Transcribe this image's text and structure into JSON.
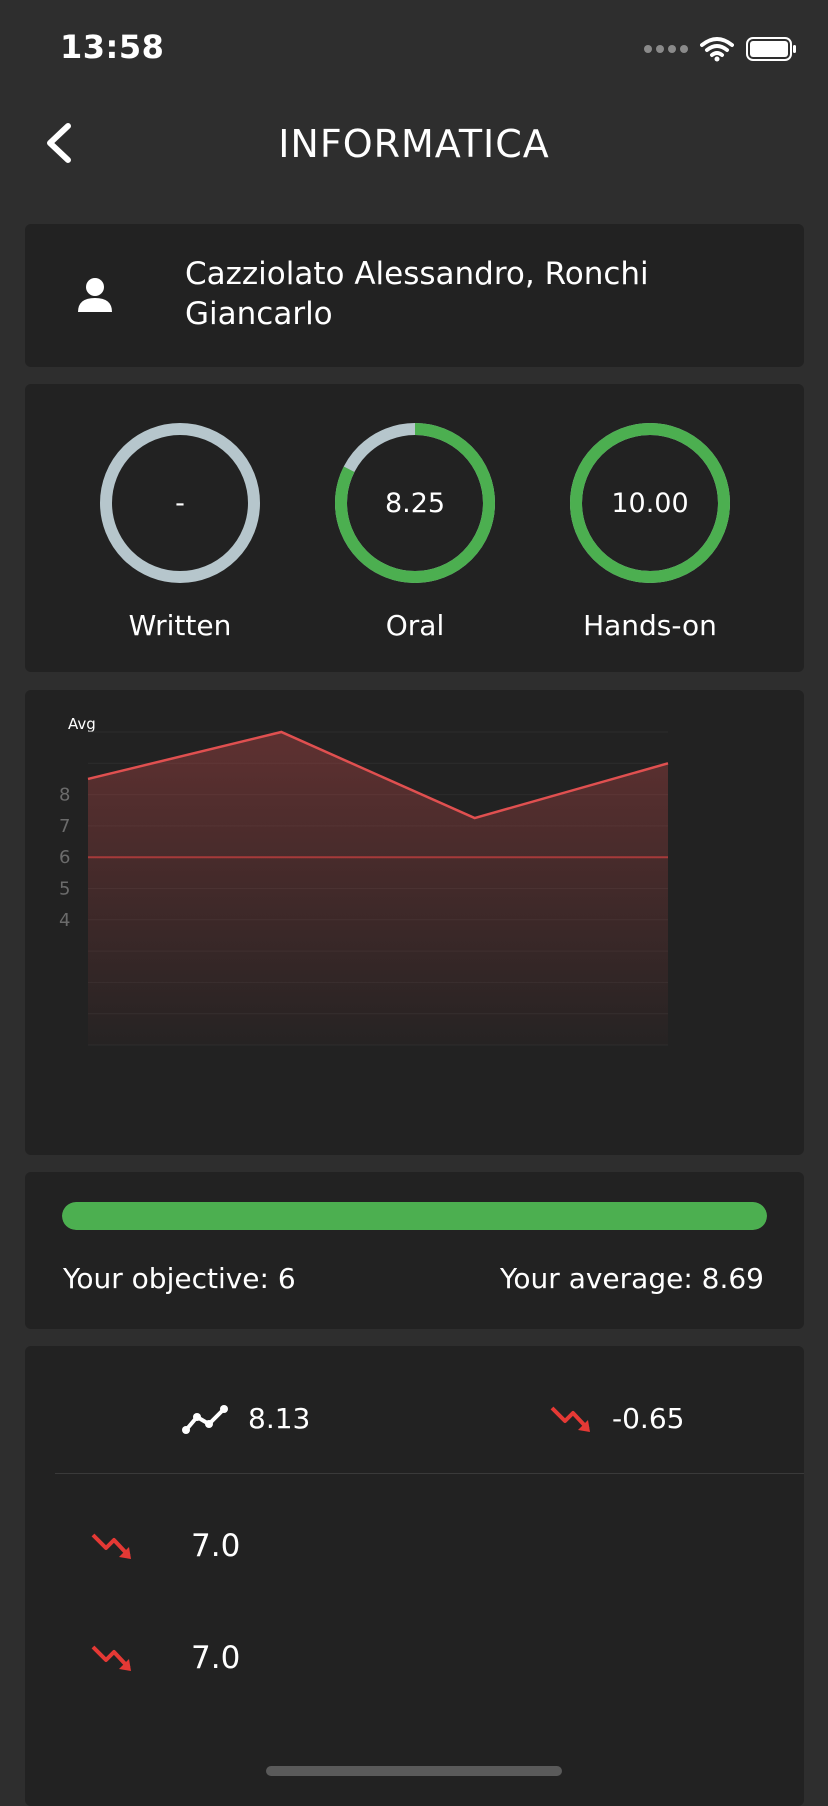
{
  "status": {
    "time": "13:58"
  },
  "header": {
    "title": "INFORMATICA"
  },
  "teachers": "Cazziolato Alessandro, Ronchi Giancarlo",
  "grades": [
    {
      "label": "Written",
      "value": "-",
      "fraction": 0,
      "color": "#b6c6cc"
    },
    {
      "label": "Oral",
      "value": "8.25",
      "fraction": 0.825,
      "color": "#4caf50"
    },
    {
      "label": "Hands-on",
      "value": "10.00",
      "fraction": 1.0,
      "color": "#4caf50"
    }
  ],
  "chart_data": {
    "type": "area",
    "title": "Avg",
    "x": [
      1,
      2,
      3,
      4
    ],
    "values": [
      8.5,
      10.0,
      7.25,
      9.0
    ],
    "y_tick_labels": [
      "8",
      "7",
      "6",
      "5",
      "4"
    ],
    "ylim": [
      0,
      10
    ],
    "threshold": 6,
    "line_color": "#e05050",
    "grid": true
  },
  "progress": {
    "objective_text": "Your objective: 6",
    "average_text": "Your average: 8.69",
    "fill_fraction": 1.0,
    "fill_color": "#4caf50"
  },
  "stats": {
    "trend_value": "8.13",
    "change_value": "-0.65",
    "rows": [
      {
        "icon": "trend-down-icon",
        "value": "7.0"
      },
      {
        "icon": "trend-down-icon",
        "value": "7.0"
      }
    ]
  }
}
